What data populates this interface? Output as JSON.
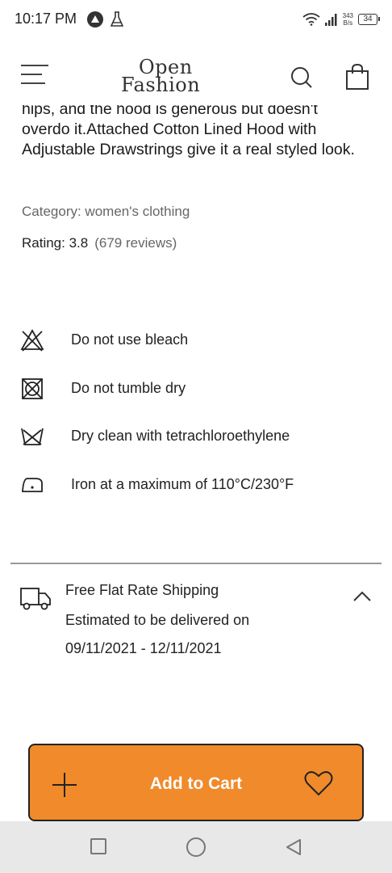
{
  "status_bar": {
    "time": "10:17 PM",
    "net_speed_value": "343",
    "net_speed_unit": "B/s",
    "battery": "34",
    "icons": [
      "app-icon",
      "flask-icon",
      "wifi-icon",
      "signal-icon",
      "battery-icon"
    ]
  },
  "header": {
    "logo_line1": "Open",
    "logo_line2": "Fashion",
    "icons": [
      "menu-icon",
      "search-icon",
      "shopping-bag-icon"
    ]
  },
  "product": {
    "description": "hips, and the hood is generous but doesn't overdo it.Attached Cotton Lined Hood with Adjustable Drawstrings give it a real styled look.",
    "category": "Category: women's clothing",
    "rating_label": "Rating: 3.8",
    "reviews": "(679 reviews)"
  },
  "care": [
    {
      "icon": "no-bleach-icon",
      "label": "Do not use bleach"
    },
    {
      "icon": "no-tumble-dry-icon",
      "label": "Do not tumble dry"
    },
    {
      "icon": "dry-clean-icon",
      "label": "Dry clean with tetrachloroethylene"
    },
    {
      "icon": "iron-icon",
      "label": "Iron at a maximum of 110°C/230°F"
    }
  ],
  "shipping": {
    "title": "Free Flat Rate Shipping",
    "estimate": "Estimated to be delivered on",
    "dates": "09/11/2021 - 12/11/2021",
    "icons": [
      "truck-icon",
      "chevron-up-icon"
    ]
  },
  "cart": {
    "label": "Add to Cart",
    "accent_color": "#f08a2a",
    "icons": [
      "plus-icon",
      "heart-icon"
    ]
  },
  "nav_bar": {
    "icons": [
      "recents-icon",
      "home-icon",
      "back-icon"
    ]
  }
}
